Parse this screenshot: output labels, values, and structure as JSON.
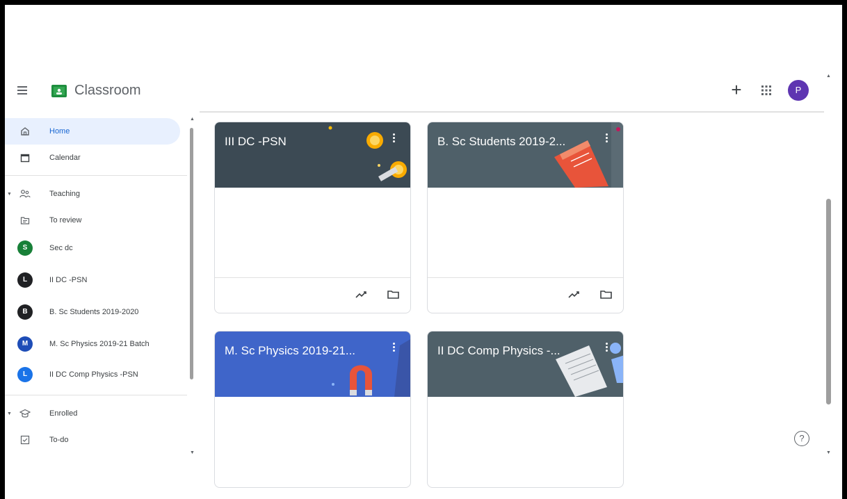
{
  "app": {
    "title": "Classroom",
    "avatar_letter": "P",
    "avatar_color": "#5e35b1"
  },
  "header": {
    "create_label": "+"
  },
  "sidebar": {
    "items": [
      {
        "label": "Home",
        "icon": "home-icon",
        "active": true
      },
      {
        "label": "Calendar",
        "icon": "calendar-icon"
      },
      {
        "label": "Teaching",
        "icon": "people-icon"
      },
      {
        "label": "To review",
        "icon": "folder-review-icon"
      },
      {
        "label": "Sec dc",
        "letter": "S",
        "color": "#188038"
      },
      {
        "label": "II DC -PSN",
        "letter": "L",
        "color": "#202124"
      },
      {
        "label": "B. Sc Students 2019-2020",
        "letter": "B",
        "color": "#202124"
      },
      {
        "label": "M. Sc Physics 2019-21 Batch",
        "letter": "M",
        "color": "#1e4db7"
      },
      {
        "label": "II DC Comp Physics -PSN",
        "letter": "L",
        "color": "#1a73e8"
      },
      {
        "label": "Enrolled",
        "icon": "school-icon"
      },
      {
        "label": "To-do",
        "icon": "todo-icon"
      }
    ]
  },
  "cards": [
    {
      "title": "III DC -PSN",
      "color": "#3c4a54"
    },
    {
      "title": "B. Sc Students 2019-2...",
      "color": "#4f6069"
    },
    {
      "title": "M. Sc Physics 2019-21...",
      "color": "#3f65c9"
    },
    {
      "title": "II DC Comp Physics -...",
      "color": "#4f6069"
    }
  ],
  "help": {
    "label": "?"
  }
}
